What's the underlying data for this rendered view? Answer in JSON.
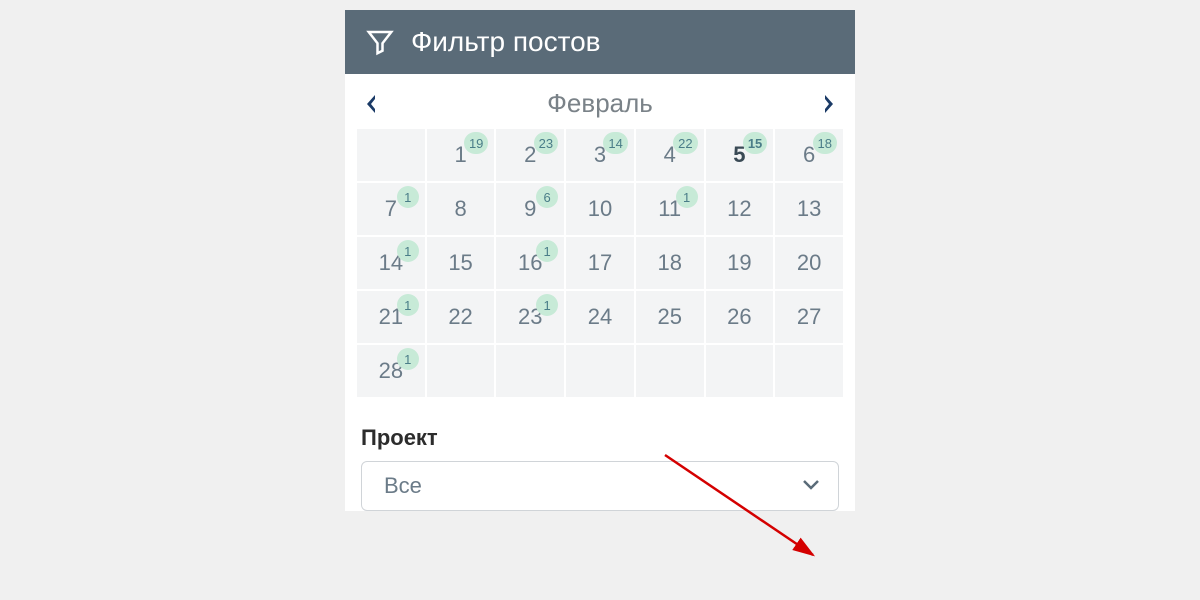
{
  "header": {
    "title": "Фильтр постов"
  },
  "calendar": {
    "month_label": "Февраль",
    "leading_blanks": 1,
    "today": 5,
    "days": [
      {
        "n": 1,
        "badge": 19
      },
      {
        "n": 2,
        "badge": 23
      },
      {
        "n": 3,
        "badge": 14
      },
      {
        "n": 4,
        "badge": 22
      },
      {
        "n": 5,
        "badge": 15
      },
      {
        "n": 6,
        "badge": 18
      },
      {
        "n": 7,
        "badge": 1
      },
      {
        "n": 8
      },
      {
        "n": 9,
        "badge": 6
      },
      {
        "n": 10
      },
      {
        "n": 11,
        "badge": 1
      },
      {
        "n": 12
      },
      {
        "n": 13
      },
      {
        "n": 14,
        "badge": 1
      },
      {
        "n": 15
      },
      {
        "n": 16,
        "badge": 1
      },
      {
        "n": 17
      },
      {
        "n": 18
      },
      {
        "n": 19
      },
      {
        "n": 20
      },
      {
        "n": 21,
        "badge": 1
      },
      {
        "n": 22
      },
      {
        "n": 23,
        "badge": 1
      },
      {
        "n": 24
      },
      {
        "n": 25
      },
      {
        "n": 26
      },
      {
        "n": 27
      },
      {
        "n": 28,
        "badge": 1
      }
    ]
  },
  "project": {
    "label": "Проект",
    "selected": "Все"
  }
}
